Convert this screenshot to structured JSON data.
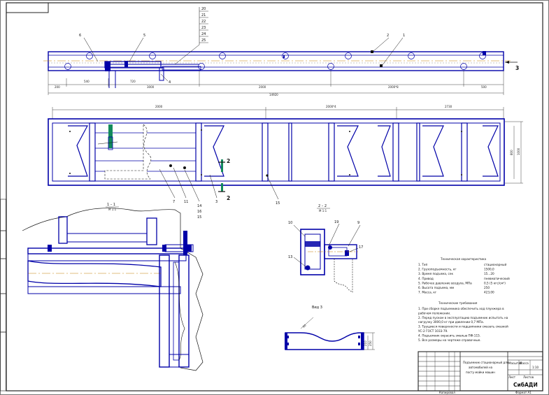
{
  "callouts": {
    "c20": "20",
    "c21": "21",
    "c22": "22",
    "c23": "23",
    "c24": "24",
    "c25": "25",
    "c1": "1",
    "c2": "2",
    "c3": "3",
    "c4": "4",
    "c5": "5",
    "c6": "6",
    "c7": "7",
    "c11": "11",
    "c14": "14",
    "c16": "16",
    "c15": "15",
    "c15b": "15",
    "c9": "9",
    "c10": "10",
    "c13": "13",
    "c17": "17",
    "c19": "19"
  },
  "view_marks": {
    "arrow3": "3",
    "cut2_top": "2",
    "cut2_bottom": "2",
    "section1": "1 – 1",
    "section1_scale": "М 1:1",
    "section2": "2 – 2",
    "section2_scale": "М 1:1",
    "view_label": "Вид 3"
  },
  "dims_top": {
    "d200": "200",
    "d540": "540",
    "d720": "720",
    "d3000": "3000",
    "d2000": "2000",
    "d2000x8": "2000*8",
    "d500": "500",
    "total": "14920"
  },
  "dims_mid": {
    "d2000": "2000",
    "d2000x4": "2000*4",
    "d2730": "2730",
    "h800": "800",
    "h1000": "1000"
  },
  "dims_detail": {
    "v210": "210",
    "v250": "250",
    "a60": "60"
  },
  "specs": {
    "title": "Техническая характеристика",
    "rows": [
      {
        "n": "1. Тип",
        "v": "стационарный"
      },
      {
        "n": "2. Грузоподъемность, кг",
        "v": "1500,0"
      },
      {
        "n": "3. Время подъема, сек",
        "v": "15...20"
      },
      {
        "n": "4. Привод",
        "v": "пневматический"
      },
      {
        "n": "5. Рабочее давление воздуха, МПа",
        "v": "0,5 (5 кгс/см²)"
      },
      {
        "n": "6. Высота подъема, мм",
        "v": "250"
      },
      {
        "n": "7. Масса, кг",
        "v": "423,00"
      }
    ]
  },
  "requirements": {
    "title": "Технические требования",
    "rows": [
      "1. При сборке подъемника обеспечить ход плунжера в",
      "   рабочем положении.",
      "2. Перед пуском в эксплуатацию подъемник испытать на",
      "   нагрузку 3000,0 кг при давлении 0,7 МПа.",
      "3. Трущиеся поверхности и подшипники смазать смазкой",
      "   УС-2 ГОСТ 1033-79.",
      "4. Подъемник окрасить эмалью ПФ-115.",
      "5. Все размеры на чертеже справочные."
    ]
  },
  "titleblock": {
    "name_line1": "Подъемник стационарный для",
    "name_line2": "автомобилей на",
    "name_line3": "посту мойки машин",
    "sheet": "Лист",
    "sheets": "Листов",
    "scale_lbl": "Масштаб",
    "mass_lbl": "Масса",
    "scale": "1:10",
    "org": "СибАДИ",
    "format": "Формат А1",
    "copied": "Копировал"
  }
}
